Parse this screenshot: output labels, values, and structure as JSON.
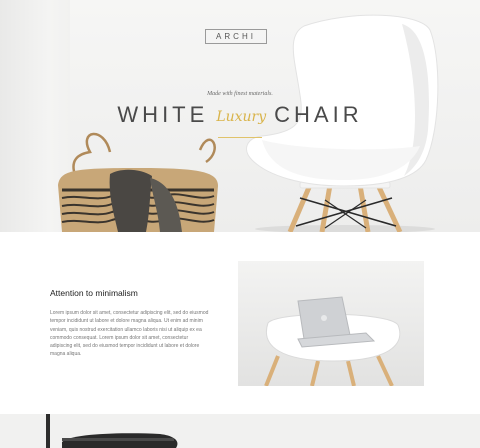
{
  "brand": {
    "logo_text": "ARCHI"
  },
  "hero": {
    "tagline": "Made with finest materials.",
    "headline_left": "WHITE",
    "headline_script": "Luxury",
    "headline_right": "CHAIR"
  },
  "feature": {
    "title": "Attention to minimalism",
    "body": "Lorem ipsum dolor sit amet, consectetur adipiscing elit, sed do eiusmod tempor incididunt ut labore et dolore magna aliqua. Ut enim ad minim veniam, quis nostrud exercitation ullamco laboris nisi ut aliquip ex ea commodo consequat. Lorem ipsum dolor sit amet, consectetur adipiscing elit, sed do eiusmod tempor incididunt ut labore et dolore magna aliqua."
  },
  "colors": {
    "accent": "#d9b44a",
    "hero_bg": "#f1f1f0",
    "text_dark": "#4a4a4a"
  }
}
